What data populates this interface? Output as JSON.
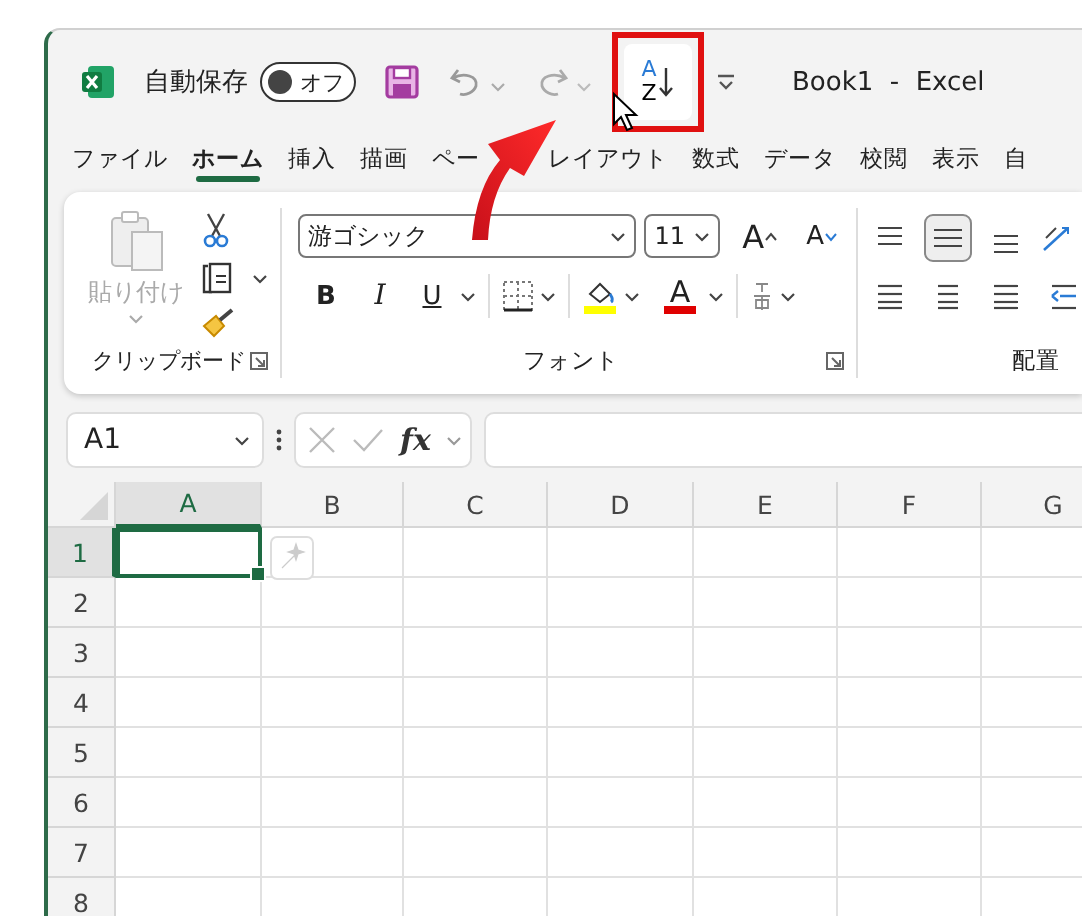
{
  "title_bar": {
    "autosave_label": "自動保存",
    "autosave_toggle": {
      "label": "オフ",
      "on": false
    },
    "sort_button": {
      "top": "A",
      "bottom": "Z",
      "highlighted": true
    },
    "title": "Book1  -  Excel"
  },
  "tabs": [
    {
      "parts": [
        "ファイル"
      ],
      "selected": false
    },
    {
      "parts": [
        "ホーム"
      ],
      "selected": true
    },
    {
      "parts": [
        "挿入"
      ],
      "selected": false
    },
    {
      "parts": [
        "描画"
      ],
      "selected": false
    },
    {
      "parts": [
        "ペー",
        "レイアウト"
      ],
      "selected": false
    },
    {
      "parts": [
        "数式"
      ],
      "selected": false
    },
    {
      "parts": [
        "データ"
      ],
      "selected": false
    },
    {
      "parts": [
        "校閲"
      ],
      "selected": false
    },
    {
      "parts": [
        "表示"
      ],
      "selected": false
    },
    {
      "parts": [
        "自"
      ],
      "selected": false
    }
  ],
  "ribbon": {
    "clipboard": {
      "paste_label": "貼り付け",
      "paste_disabled": true,
      "group_label": "クリップボード"
    },
    "font": {
      "font_name": "游ゴシック",
      "font_size": "11",
      "grow": "A",
      "shrink": "A",
      "bold": "B",
      "italic": "I",
      "underline": "U",
      "font_color": "A",
      "group_label": "フォント"
    },
    "alignment": {
      "group_label": "配置"
    }
  },
  "formula_bar": {
    "name_box": "A1",
    "fx": "fx"
  },
  "grid": {
    "columns": [
      {
        "label": "A",
        "selected": true
      },
      {
        "label": "B",
        "selected": false
      },
      {
        "label": "C",
        "selected": false
      },
      {
        "label": "D",
        "selected": false
      },
      {
        "label": "E",
        "selected": false
      },
      {
        "label": "F",
        "selected": false
      },
      {
        "label": "G",
        "selected": false
      }
    ],
    "rows": [
      {
        "label": "1",
        "selected": true
      },
      {
        "label": "2",
        "selected": false
      },
      {
        "label": "3",
        "selected": false
      },
      {
        "label": "4",
        "selected": false
      },
      {
        "label": "5",
        "selected": false
      },
      {
        "label": "6",
        "selected": false
      },
      {
        "label": "7",
        "selected": false
      },
      {
        "label": "8",
        "selected": false
      }
    ]
  }
}
